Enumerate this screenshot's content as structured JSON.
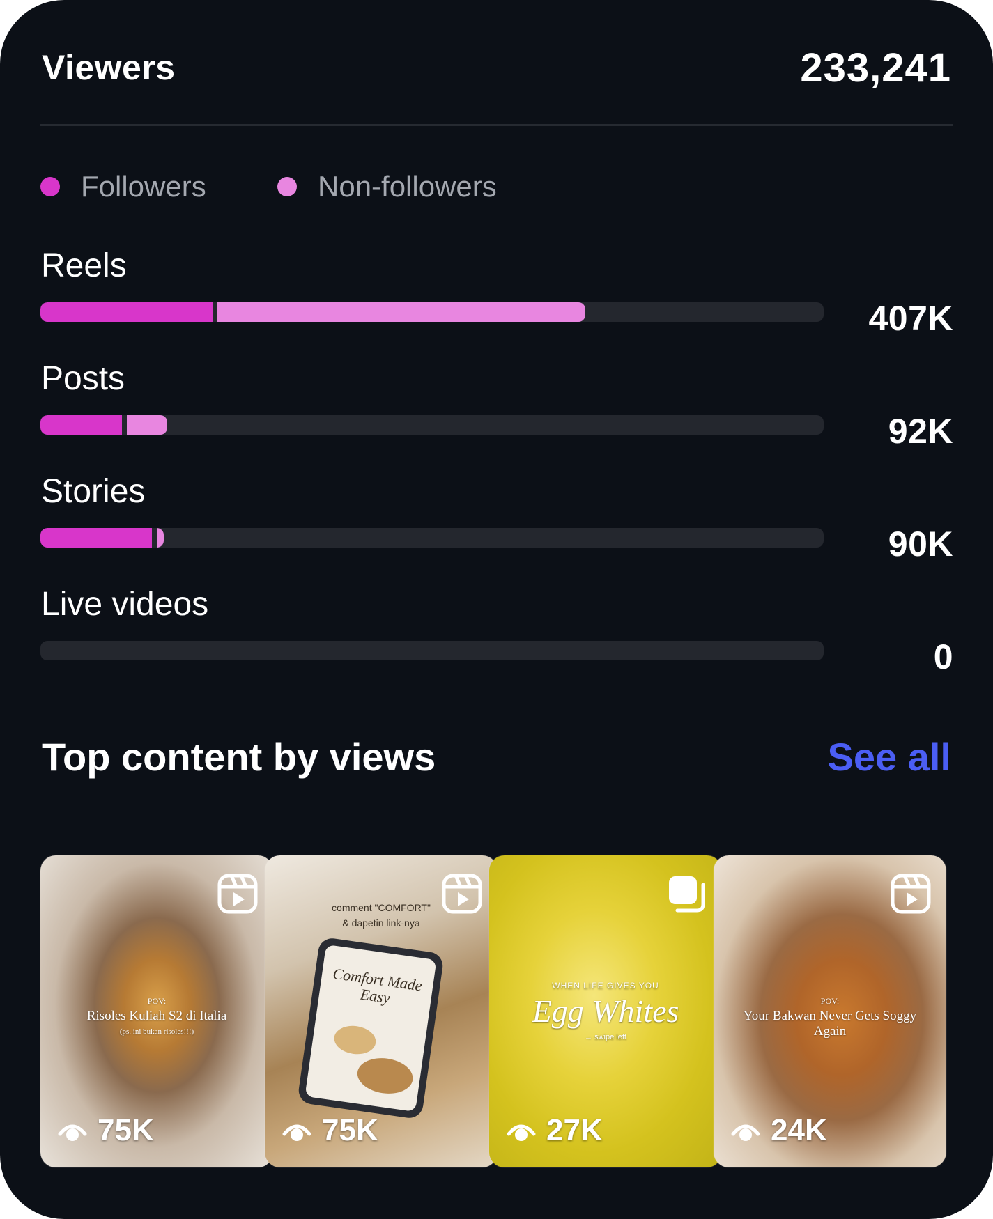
{
  "viewers": {
    "title": "Viewers",
    "total": "233,241"
  },
  "legend": [
    {
      "label": "Followers",
      "color": "#d836ca"
    },
    {
      "label": "Non-followers",
      "color": "#e886e0"
    }
  ],
  "metrics": [
    {
      "label": "Reels",
      "value": "407K",
      "followers_fraction": 0.22,
      "non_followers_fraction": 0.47
    },
    {
      "label": "Posts",
      "value": "92K",
      "followers_fraction": 0.104,
      "non_followers_fraction": 0.052
    },
    {
      "label": "Stories",
      "value": "90K",
      "followers_fraction": 0.142,
      "non_followers_fraction": 0.009
    },
    {
      "label": "Live videos",
      "value": "0",
      "followers_fraction": 0,
      "non_followers_fraction": 0
    }
  ],
  "top_content": {
    "title": "Top content by views",
    "see_all": "See all",
    "items": [
      {
        "views": "75K",
        "type_icon": "reel-icon",
        "caption_small": "POV:",
        "caption_main": "Risoles Kuliah S2 di Italia",
        "caption_sub": "(ps. ini bukan risoles!!!)"
      },
      {
        "views": "75K",
        "type_icon": "reel-icon",
        "caption_small": "comment \"COMFORT\"",
        "caption_main": "Comfort Made Easy",
        "caption_sub": "& dapetin link-nya"
      },
      {
        "views": "27K",
        "type_icon": "carousel-icon",
        "caption_small": "WHEN LIFE GIVES YOU",
        "caption_main": "Egg Whites",
        "caption_sub": "→ swipe left"
      },
      {
        "views": "24K",
        "type_icon": "reel-icon",
        "caption_small": "POV:",
        "caption_main": "Your Bakwan Never Gets Soggy Again",
        "caption_sub": ""
      }
    ]
  }
}
